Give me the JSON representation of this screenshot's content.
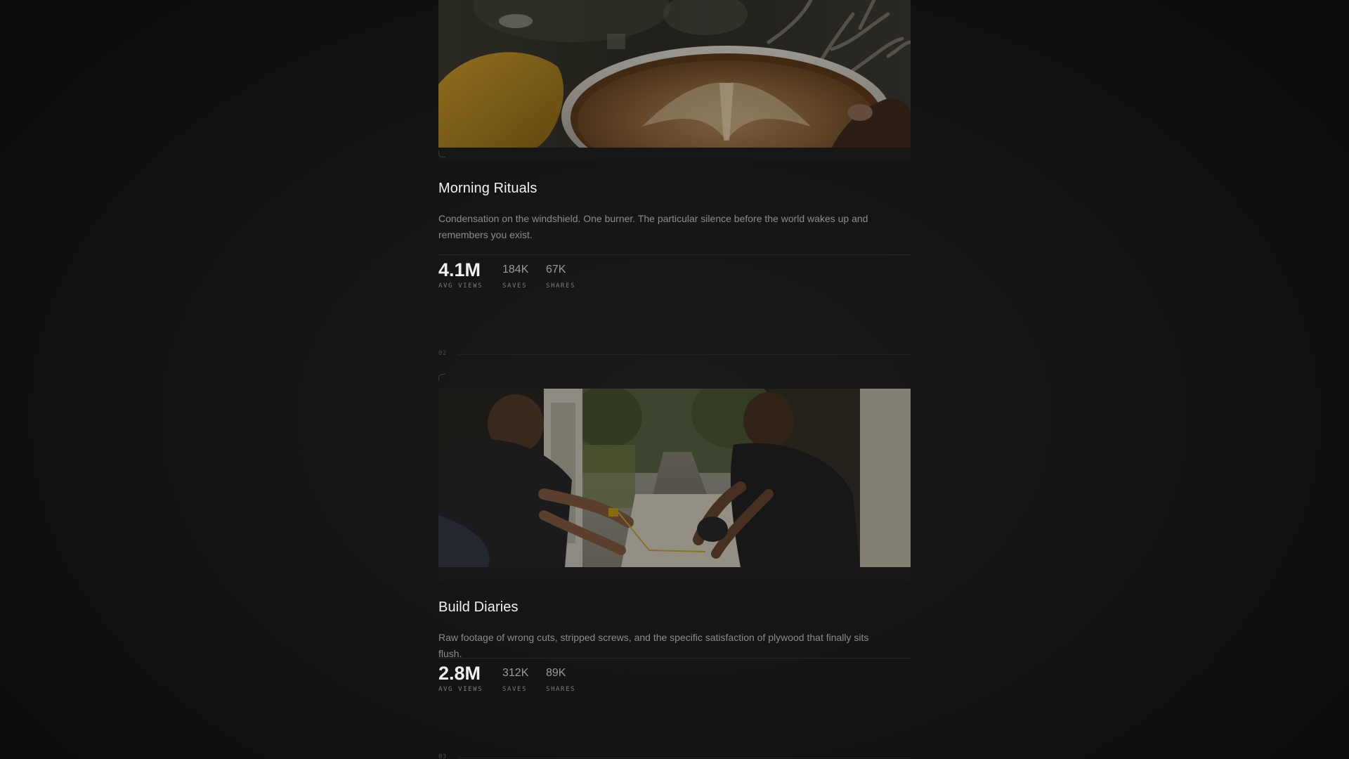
{
  "cards": [
    {
      "index": "",
      "image_icon": "coffee-latte-photo",
      "title": "Morning Rituals",
      "description": "Condensation on the windshield. One burner. The particular silence before the world wakes up and remembers you exist.",
      "stats": {
        "avg_views": "4.1M",
        "avg_views_label": "AVG VIEWS",
        "saves": "184K",
        "saves_label": "SAVES",
        "shares": "67K",
        "shares_label": "SHARES"
      }
    },
    {
      "index": "02",
      "image_icon": "van-build-photo",
      "title": "Build Diaries",
      "description": "Raw footage of wrong cuts, stripped screws, and the specific satisfaction of plywood that finally sits flush.",
      "stats": {
        "avg_views": "2.8M",
        "avg_views_label": "AVG VIEWS",
        "saves": "312K",
        "saves_label": "SAVES",
        "shares": "89K",
        "shares_label": "SHARES"
      }
    },
    {
      "index": "03"
    }
  ],
  "colors": {
    "background": "#121212",
    "title": "#f2f2f2",
    "description": "#8c8c8c",
    "stat_label": "#7c7c7c"
  }
}
